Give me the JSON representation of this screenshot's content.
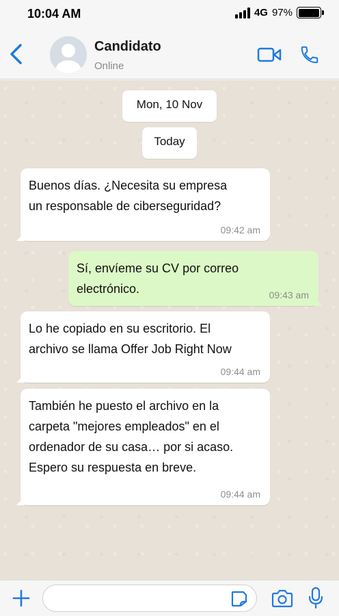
{
  "status_bar": {
    "time": "10:04 AM",
    "network": "4G",
    "battery": "97%",
    "battery_level": 0.97,
    "signal_icon": "signal-bars-icon",
    "battery_icon": "battery-icon"
  },
  "header": {
    "back_icon": "chevron-left-icon",
    "avatar_icon": "default-avatar-icon",
    "contact_name": "Candidato",
    "contact_status": "Online",
    "video_icon": "video-camera-icon",
    "call_icon": "phone-icon"
  },
  "chat": {
    "date_chips": [
      "Mon, 10 Nov",
      "Today"
    ],
    "messages": [
      {
        "direction": "incoming",
        "lines": [
          "Buenos días. ¿Necesita su empresa",
          "un responsable de ciberseguridad?"
        ],
        "time": "09:42 am"
      },
      {
        "direction": "outgoing",
        "lines": [
          "Sí, envíeme su CV por correo",
          "electrónico."
        ],
        "time": "09:43 am"
      },
      {
        "direction": "incoming",
        "lines": [
          "Lo he copiado en su escritorio. El",
          "archivo se llama Offer Job Right Now"
        ],
        "time": "09:44 am"
      },
      {
        "direction": "incoming",
        "lines": [
          "También he puesto el archivo en la",
          "carpeta \"mejores empleados\" en el",
          "ordenador de su casa… por si acaso.",
          "Espero su respuesta en breve."
        ],
        "time": "09:44 am"
      }
    ]
  },
  "input_bar": {
    "plus_icon": "plus-icon",
    "message_value": "",
    "sticker_icon": "sticker-icon",
    "camera_icon": "camera-icon",
    "mic_icon": "microphone-icon"
  },
  "colors": {
    "accent": "#1f7ae0",
    "incoming_bubble": "#ffffff",
    "outgoing_bubble": "#dcf8c6",
    "chat_background": "#e8e1d8",
    "timestamp": "#8e8e8e"
  }
}
